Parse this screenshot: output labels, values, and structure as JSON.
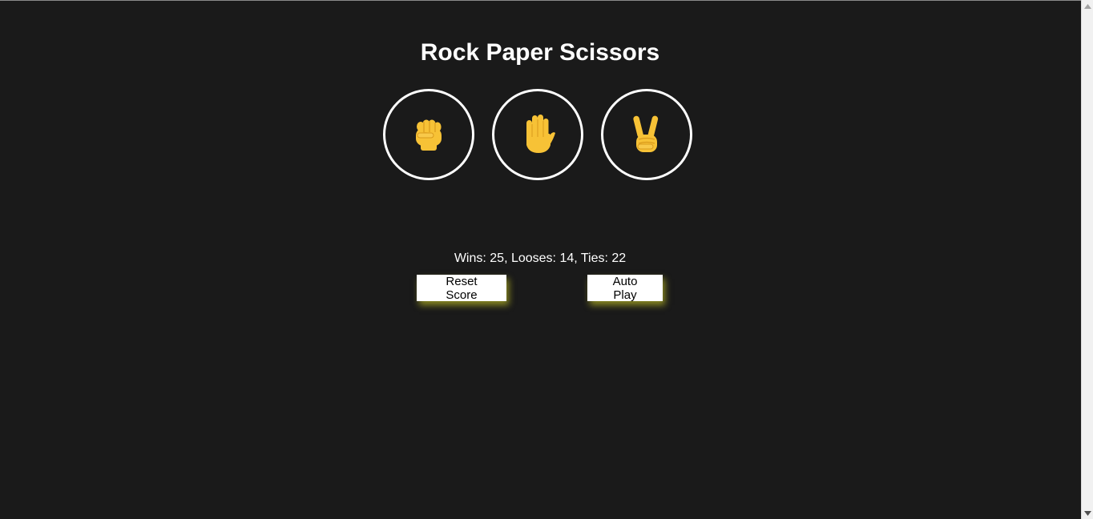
{
  "title": "Rock Paper Scissors",
  "moves": [
    {
      "id": "rock",
      "icon": "raised-fist-icon"
    },
    {
      "id": "paper",
      "icon": "raised-hand-icon"
    },
    {
      "id": "scissors",
      "icon": "victory-hand-icon"
    }
  ],
  "score": {
    "text": "Wins: 25, Looses: 14, Ties: 22",
    "wins": 25,
    "losses": 14,
    "ties": 22
  },
  "buttons": {
    "reset_label": "Reset Score",
    "autoplay_label": "Auto Play"
  },
  "colors": {
    "background": "#1a1a1a",
    "ring": "#ffffff",
    "emoji_skin": "#f7c236",
    "button_glow": "#e6e628"
  }
}
